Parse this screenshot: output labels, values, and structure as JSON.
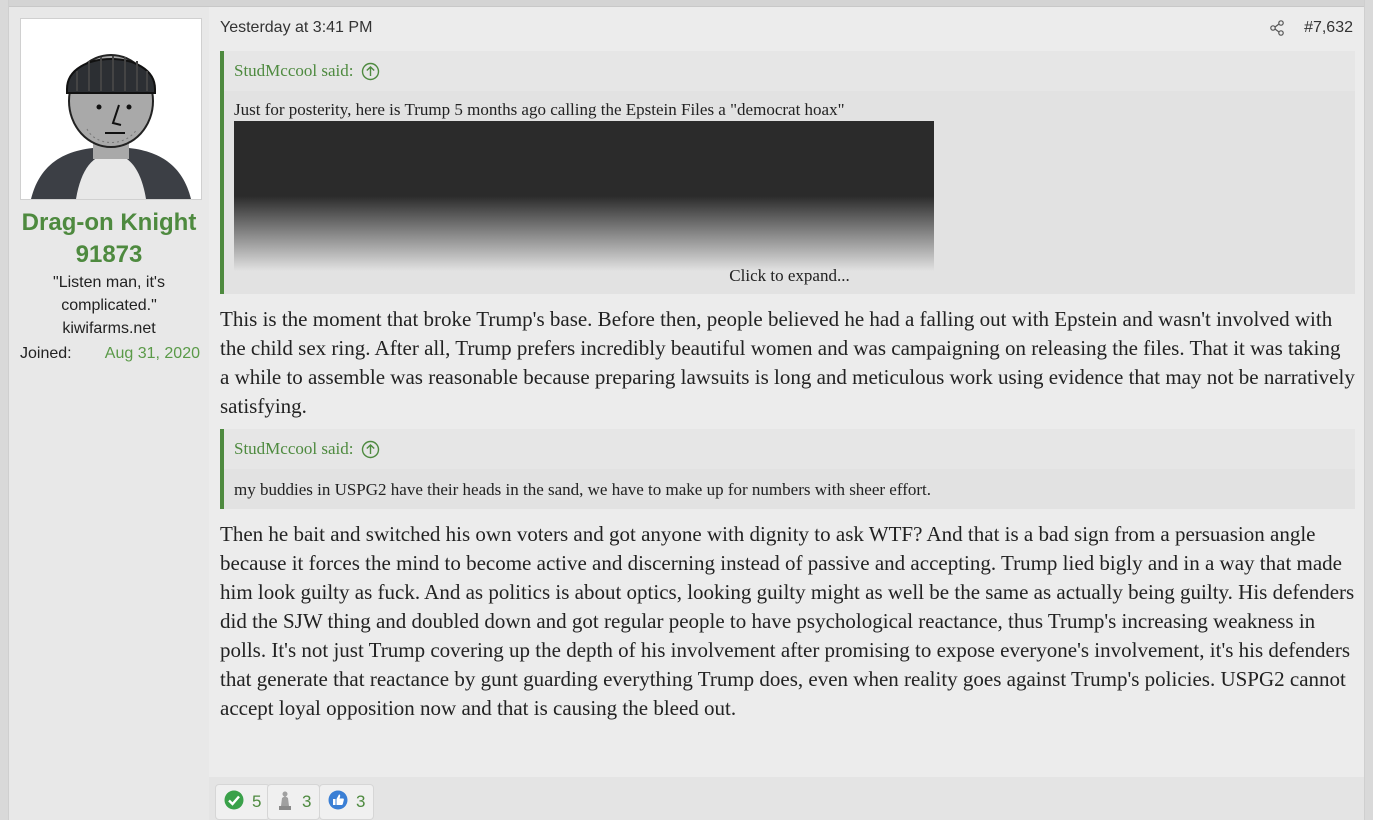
{
  "post": {
    "timestamp": "Yesterday at 3:41 PM",
    "number": "#7,632"
  },
  "user": {
    "name": "Drag-on Knight 91873",
    "title_line1": "\"Listen man, it's",
    "title_line2": "complicated.\"",
    "title_line3": "kiwifarms.net",
    "joined_label": "Joined:",
    "joined_value": "Aug 31, 2020"
  },
  "quote1": {
    "author": "StudMccool said:",
    "text": "Just for posterity, here is Trump 5 months ago calling the Epstein Files a \"democrat hoax\"",
    "expand": "Click to expand..."
  },
  "paragraph1": "This is the moment that broke Trump's base. Before then, people believed he had a falling out with Epstein and wasn't involved with the child sex ring. After all, Trump prefers incredibly beautiful women and was campaigning on releasing the files. That it was taking a while to assemble was reasonable because preparing lawsuits is long and meticulous work using evidence that may not be narratively satisfying.",
  "quote2": {
    "author": "StudMccool said:",
    "text": "my buddies in USPG2 have their heads in the sand, we have to make up for numbers with sheer effort."
  },
  "paragraph2": "Then he bait and switched his own voters and got anyone with dignity to ask WTF? And that is a bad sign from a persuasion angle because it forces the mind to become active and discerning instead of passive and accepting. Trump lied bigly and in a way that made him look guilty as fuck. And as politics is about optics, looking guilty might as well be the same as actually being guilty. His defenders did the SJW thing and doubled down and got regular people to have psychological reactance, thus Trump's increasing weakness in polls. It's not just Trump covering up the depth of his involvement after promising to expose everyone's involvement, it's his defenders that generate that reactance by gunt guarding everything Trump does, even when reality goes against Trump's policies. USPG2 cannot accept loyal opposition now and that is causing the bleed out.",
  "reactions": [
    {
      "icon": "checkmark-icon",
      "count": "5"
    },
    {
      "icon": "statue-icon",
      "count": "3"
    },
    {
      "icon": "thumbs-up-icon",
      "count": "3"
    }
  ],
  "colors": {
    "accent": "#4e8a3f",
    "check": "#3aa14a",
    "like": "#3a7fd5"
  }
}
